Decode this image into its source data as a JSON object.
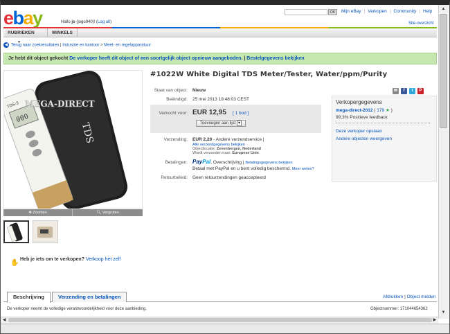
{
  "header": {
    "logo_letters": [
      {
        "ch": "e",
        "color": "#e53238"
      },
      {
        "ch": "b",
        "color": "#0064d2"
      },
      {
        "ch": "a",
        "color": "#f5af02"
      },
      {
        "ch": "y",
        "color": "#86b817"
      }
    ],
    "greeting_prefix": "Hallo ",
    "greeting_user": "jo",
    "greeting_rest": " (jogo940)! (",
    "logout": "Log uit",
    "greeting_end": ")",
    "search_button": "OK",
    "links": [
      "Mijn eBay",
      "Verkopen",
      "Community",
      "Help"
    ],
    "site_overview": "Site-overzicht"
  },
  "nav": {
    "categories": "RUBRIEKEN",
    "caret": "▼",
    "shops": "WINKELS"
  },
  "breadcrumb": {
    "back": "Terug naar zoekresultaten",
    "sep1": " | ",
    "items": [
      "Industrie en kantoor",
      "Meet- en regelapparatuur"
    ],
    "sep": " > "
  },
  "notice": {
    "text": "Je hebt dit object gekocht",
    "highlight": " De verkoper heeft dit object of een soortgelijk object opnieuw aangeboden.",
    "sep": "  |   ",
    "link": "Bestelgegevens bekijken"
  },
  "gallery": {
    "product_brand": "MEGA-DIRECT",
    "device_label": "TDS-3",
    "device_reading": "000",
    "zoom": "Zoomen",
    "enlarge": "Vergroten"
  },
  "sell": {
    "prompt": "Heb je iets om te verkopen?",
    "link": "Verkoop het zelf"
  },
  "listing": {
    "title": "#1022W White Digital TDS Meter/Tester, Water/ppm/Purity",
    "condition_label": "Staat van object:",
    "condition_value": "Nieuw",
    "ended_label": "Beëindigd:",
    "ended_value": "25 mei 2013 19:48:03 CEST",
    "sold_label": "Verkocht voor:",
    "price": "EUR 12,95",
    "bids": "[ 1 bod ]",
    "watch_button": "Toevoegen aan lijst",
    "watch_caret": "▾",
    "shipping_label": "Verzending:",
    "shipping_value": "EUR 2,20",
    "shipping_service": " - Andere verzendservice  |",
    "shipping_details": "Alle verzendgegevens bekijken",
    "location_label": "Objectlocatie: ",
    "location_value": "Zevenbergen, Nederland",
    "ships_to_label": "Wordt verzonden naar: ",
    "ships_to_value": "Europese Unie",
    "payment_label": "Betalingen:",
    "paypal_pay": "Pay",
    "paypal_pal": "Pal",
    "payment_value": ", Overschrijving |",
    "payment_details": "Betalingsgegevens bekijken",
    "paypal_protect": "Betaal met PayPal en u bent volledig beschermd.",
    "more_info": "Meer weten?",
    "return_label": "Retourbeleid:",
    "return_value": "Geen retourzendingen geaccepteerd"
  },
  "seller": {
    "heading": "Verkopergegevens",
    "name": "mega-direct-2012",
    "score_open": " ( ",
    "score": "179",
    "score_close": " )",
    "feedback": "99,3% Positieve feedback",
    "save": "Deze verkoper opslaan",
    "other": "Andere objecten weergeven",
    "share_icons": [
      {
        "name": "email-icon",
        "char": "✉",
        "color": "#888"
      },
      {
        "name": "facebook-icon",
        "char": "f",
        "color": "#3b5998"
      },
      {
        "name": "twitter-icon",
        "char": "t",
        "color": "#33aadd"
      },
      {
        "name": "pinterest-icon",
        "char": "P",
        "color": "#cb2027"
      }
    ]
  },
  "tabs": {
    "description": "Beschrijving",
    "shipping": "Verzending en betalingen",
    "print": "Afdrukken",
    "sep": " | ",
    "report": "Object melden"
  },
  "footer": {
    "disclaimer": "De verkoper neemt de volledige verantwoordelijkheid voor deze aanbieding.",
    "object_number_label": "Objectnummer: ",
    "object_number": "171044654362"
  }
}
